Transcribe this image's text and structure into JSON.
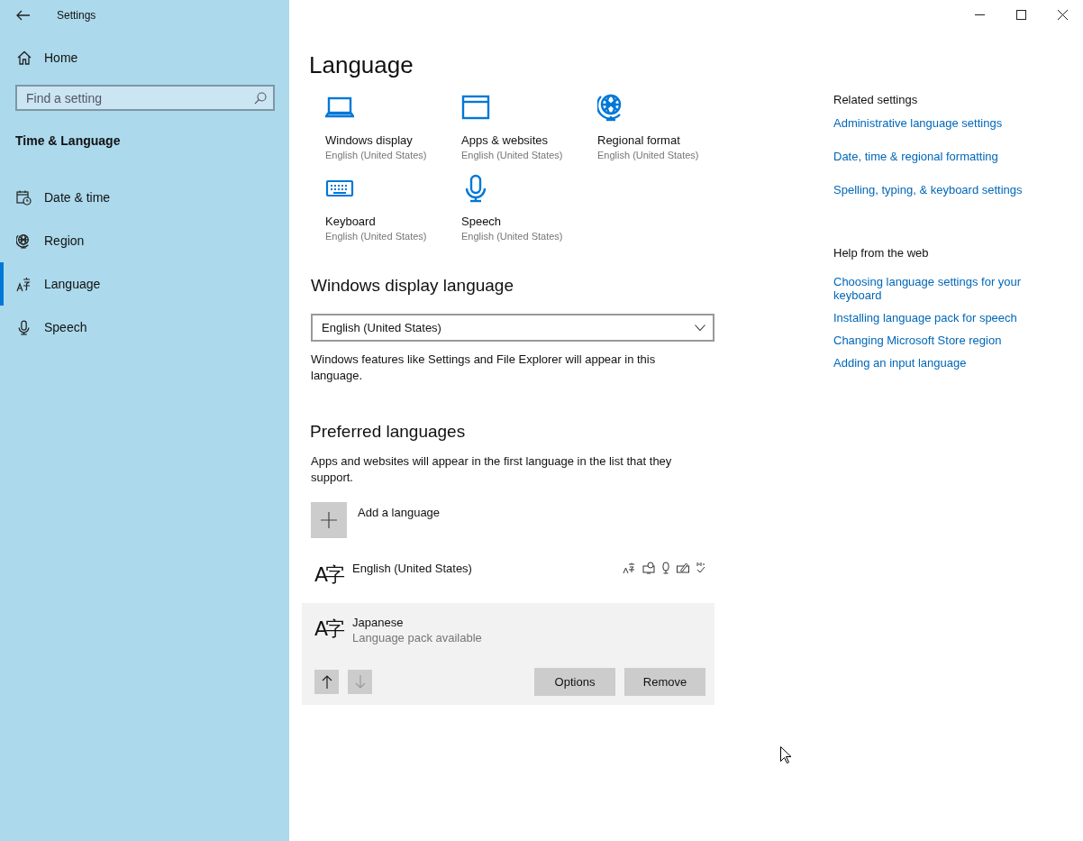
{
  "window": {
    "title": "Settings"
  },
  "sidebar": {
    "home": "Home",
    "search": {
      "placeholder": "Find a setting"
    },
    "section": "Time & Language",
    "items": [
      {
        "label": "Date & time",
        "kind": "calendar",
        "selected": false
      },
      {
        "label": "Region",
        "kind": "globe",
        "selected": false
      },
      {
        "label": "Language",
        "kind": "language",
        "selected": true
      },
      {
        "label": "Speech",
        "kind": "mic",
        "selected": false
      }
    ]
  },
  "page": {
    "title": "Language",
    "tiles": [
      {
        "kind": "laptop",
        "label": "Windows display",
        "value": "English (United States)"
      },
      {
        "kind": "window",
        "label": "Apps & websites",
        "value": "English (United States)"
      },
      {
        "kind": "globe",
        "label": "Regional format",
        "value": "English (United States)"
      },
      {
        "kind": "keyboard",
        "label": "Keyboard",
        "value": "English (United States)"
      },
      {
        "kind": "mic",
        "label": "Speech",
        "value": "English (United States)"
      }
    ],
    "display_language": {
      "heading": "Windows display language",
      "value": "English (United States)",
      "note": "Windows features like Settings and File Explorer will appear in this language."
    },
    "preferred": {
      "heading": "Preferred languages",
      "note": "Apps and websites will appear in the first language in the list that they support.",
      "add": "Add a language",
      "languages": [
        {
          "glyph": "A字",
          "name": "English (United States)",
          "features": true,
          "selected": false
        },
        {
          "glyph": "A字",
          "name": "Japanese",
          "status": "Language pack available",
          "features": false,
          "selected": true
        }
      ],
      "move_up": {
        "disabled": false
      },
      "move_down": {
        "disabled": true
      },
      "buttons": [
        "Options",
        "Remove"
      ]
    }
  },
  "related": {
    "heading": "Related settings",
    "links": [
      "Administrative language settings",
      "Date, time & regional formatting",
      "Spelling, typing, & keyboard settings"
    ]
  },
  "help": {
    "heading": "Help from the web",
    "links": [
      "Choosing language settings for your keyboard",
      "Installing language pack for speech",
      "Changing Microsoft Store region",
      "Adding an input language"
    ]
  }
}
